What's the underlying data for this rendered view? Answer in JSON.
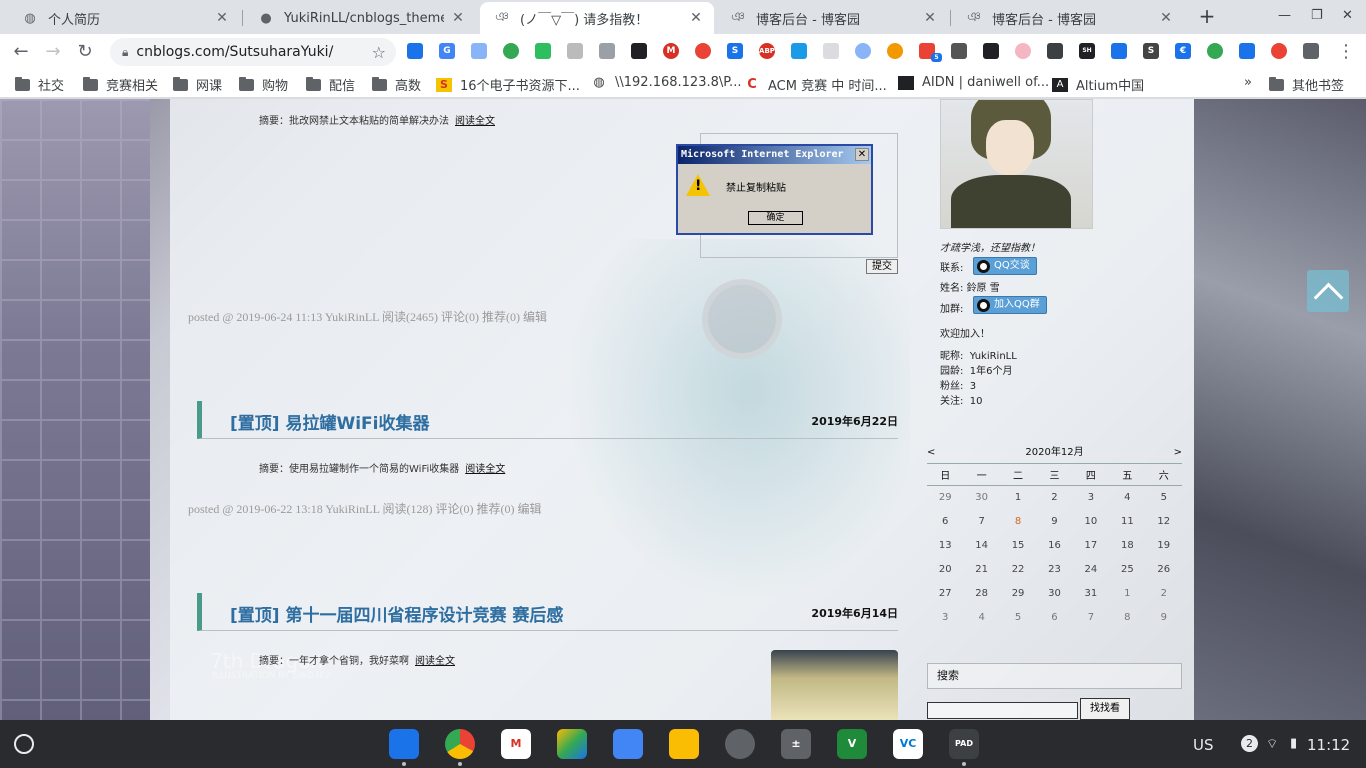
{
  "tabs": [
    {
      "title": "个人简历",
      "icon": "globe-icon"
    },
    {
      "title": "YukiRinLL/cnblogs_theme_cu",
      "icon": "github-icon"
    },
    {
      "title": "(ノ￣▽￣) 请多指教！",
      "icon": "cnblogs-icon"
    },
    {
      "title": "博客后台 - 博客园",
      "icon": "cnblogs-icon"
    },
    {
      "title": "博客后台 - 博客园",
      "icon": "cnblogs-icon"
    }
  ],
  "toolbar": {
    "url": "cnblogs.com/SutsuharaYuki/"
  },
  "extension_badges": [
    "5",
    "53",
    "10",
    "NEW",
    "1"
  ],
  "bookmarks": [
    {
      "label": "社交"
    },
    {
      "label": "竞赛相关"
    },
    {
      "label": "网课"
    },
    {
      "label": "购物"
    },
    {
      "label": "配信"
    },
    {
      "label": "高数"
    },
    {
      "label": "16个电子书资源下..."
    },
    {
      "label": "\\\\192.168.123.8\\P..."
    },
    {
      "label": "ACM 竞赛 中 时间..."
    },
    {
      "label": "AIDN | daniwell of..."
    },
    {
      "label": "Altium中国"
    }
  ],
  "bookmarks_overflow": "»",
  "other_bookmarks": "其他书签",
  "posts": {
    "top_summary": {
      "text": "摘要：批改网禁止文本粘贴的简单解决办法",
      "readmore": "阅读全文"
    },
    "meta1": "posted @ 2019-06-24 11:13 YukiRinLL 阅读(2465) 评论(0) 推荐(0) 编辑",
    "post2": {
      "title": "[置顶] 易拉罐WiFi收集器",
      "date": "2019年6月22日",
      "summary": "摘要：使用易拉罐制作一个简易的WiFi收集器",
      "readmore": "阅读全文",
      "meta": "posted @ 2019-06-22 13:18 YukiRinLL 阅读(128) 评论(0) 推荐(0) 编辑"
    },
    "post3": {
      "title": "[置顶] 第十一届四川省程序设计竞赛 赛后感",
      "date": "2019年6月14日",
      "summary": "摘要：一年才拿个省铜，我好菜啊",
      "readmore": "阅读全文"
    }
  },
  "ie_dialog": {
    "title": "Microsoft Internet Explorer",
    "message": "禁止复制粘贴",
    "ok": "确定",
    "submit": "提交"
  },
  "watermark": {
    "line1": "7th Dragon",
    "line2": "ILLUSTRATION BY SWD3E2"
  },
  "sidebar": {
    "motto": "才疏学浅，还望指教！",
    "contact_label": "联系:",
    "qq_chat": "QQ交谈",
    "name_label": "姓名:",
    "name": "鈴原 雪",
    "group_label": "加群:",
    "qq_group": "加入QQ群",
    "welcome": "欢迎加入！",
    "nickname_label": "昵称:",
    "nickname": "YukiRinLL",
    "age_label": "园龄:",
    "age": "1年6个月",
    "fans_label": "粉丝:",
    "fans": "3",
    "follow_label": "关注:",
    "follow": "10"
  },
  "calendar": {
    "prev": "<",
    "next": ">",
    "month": "2020年12月",
    "weekdays": [
      "日",
      "一",
      "二",
      "三",
      "四",
      "五",
      "六"
    ],
    "weeks": [
      [
        "29",
        "30",
        "1",
        "2",
        "3",
        "4",
        "5"
      ],
      [
        "6",
        "7",
        "8",
        "9",
        "10",
        "11",
        "12"
      ],
      [
        "13",
        "14",
        "15",
        "16",
        "17",
        "18",
        "19"
      ],
      [
        "20",
        "21",
        "22",
        "23",
        "24",
        "25",
        "26"
      ],
      [
        "27",
        "28",
        "29",
        "30",
        "31",
        "1",
        "2"
      ],
      [
        "3",
        "4",
        "5",
        "6",
        "7",
        "8",
        "9"
      ]
    ],
    "today": "8"
  },
  "search": {
    "label": "搜索",
    "button": "找找看"
  },
  "shelf": {
    "apps": [
      "files-icon",
      "chrome-icon",
      "gmail-icon",
      "drive-icon",
      "docs-icon",
      "keep-icon",
      "camera-icon",
      "calculator-icon",
      "vim-icon",
      "vscode-icon",
      "code-pad-icon"
    ],
    "ime": "US",
    "notifications": "2",
    "time": "11:12"
  }
}
